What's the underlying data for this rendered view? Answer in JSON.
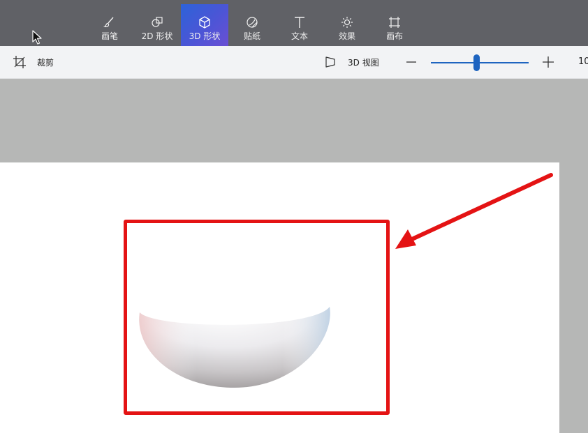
{
  "ribbon": {
    "tools": [
      {
        "id": "brushes",
        "label": "画笔",
        "icon": "brush-icon"
      },
      {
        "id": "2d-shapes",
        "label": "2D 形状",
        "icon": "2d-shapes-icon"
      },
      {
        "id": "3d-shapes",
        "label": "3D 形状",
        "icon": "cube-icon",
        "active": true
      },
      {
        "id": "stickers",
        "label": "贴纸",
        "icon": "sticker-icon"
      },
      {
        "id": "text",
        "label": "文本",
        "icon": "text-icon"
      },
      {
        "id": "effects",
        "label": "效果",
        "icon": "sun-icon"
      },
      {
        "id": "canvas",
        "label": "画布",
        "icon": "canvas-icon"
      }
    ]
  },
  "toolbar": {
    "crop_label": "裁剪",
    "view3d_label": "3D 视图",
    "zoom": {
      "value_text": "10",
      "slider_level": 0.47
    }
  },
  "colors": {
    "ribbon_bg": "#606166",
    "active_tool": "#3d5bd7",
    "accent": "#1e64c0",
    "annotation": "#e41314",
    "canvas": "#ffffff",
    "workspace": "#b6b7b6"
  }
}
